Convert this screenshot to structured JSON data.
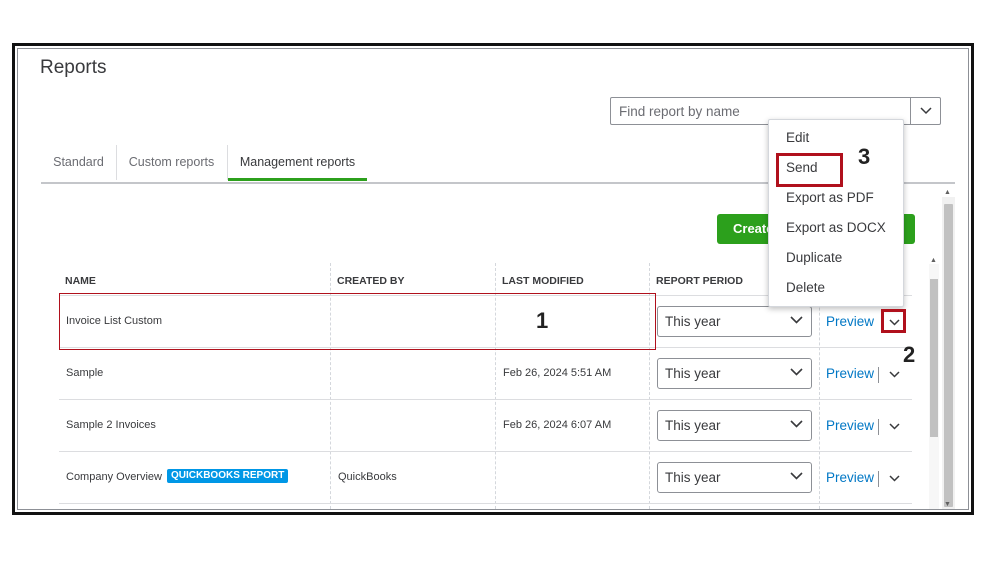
{
  "page": {
    "title": "Reports",
    "search": {
      "placeholder": "Find report by name"
    },
    "tabs": [
      "Standard",
      "Custom reports",
      "Management reports"
    ],
    "active_tab": "Management reports",
    "create_button": "Create"
  },
  "table": {
    "headers": [
      "NAME",
      "CREATED BY",
      "LAST MODIFIED",
      "REPORT PERIOD"
    ],
    "rows": [
      {
        "name": "Invoice List Custom",
        "created_by": "",
        "last_modified": "",
        "period": "This year",
        "action": "Preview"
      },
      {
        "name": "Sample",
        "created_by": "",
        "last_modified": "Feb 26, 2024 5:51 AM",
        "period": "This year",
        "action": "Preview"
      },
      {
        "name": "Sample 2 Invoices",
        "created_by": "",
        "last_modified": "Feb 26, 2024 6:07 AM",
        "period": "This year",
        "action": "Preview"
      },
      {
        "name": "Company Overview",
        "badge": "QUICKBOOKS REPORT",
        "created_by": "QuickBooks",
        "last_modified": "",
        "period": "This year",
        "action": "Preview"
      }
    ]
  },
  "menu": {
    "items": [
      "Edit",
      "Send",
      "Export as PDF",
      "Export as DOCX",
      "Duplicate",
      "Delete"
    ]
  },
  "annotations": {
    "step1": "1",
    "step2": "2",
    "step3": "3"
  },
  "colors": {
    "accent": "#2ca01c",
    "link": "#0077c5",
    "badge": "#0097e6",
    "annotation": "#b0101c"
  },
  "icons": {
    "chevron": "chevron-down-icon"
  }
}
